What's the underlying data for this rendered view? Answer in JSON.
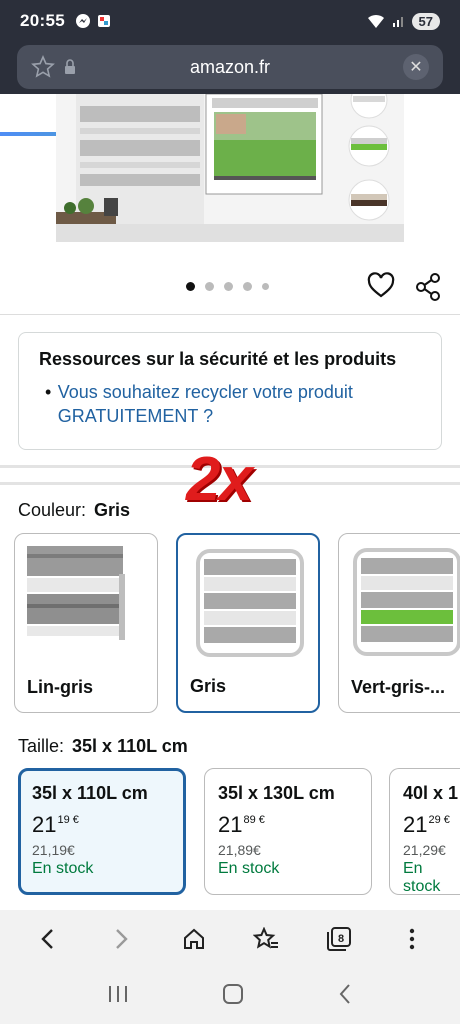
{
  "status_bar": {
    "time": "20:55",
    "battery": "57"
  },
  "url_bar": {
    "url": "amazon.fr"
  },
  "carousel": {
    "dot_count": 5,
    "active_index": 0
  },
  "resources": {
    "title": "Ressources sur la sécurité et les produits",
    "link_text": "Vous souhaitez recycler votre produit GRATUITEMENT ?"
  },
  "overlay_text": "2x",
  "color": {
    "label": "Couleur:",
    "selected": "Gris",
    "options": [
      {
        "name": "Lin-gris"
      },
      {
        "name": "Gris"
      },
      {
        "name": "Vert-gris-..."
      }
    ]
  },
  "size": {
    "label": "Taille:",
    "selected": "35l x 110L cm",
    "options": [
      {
        "name": "35l x 110L cm",
        "price_whole": "21",
        "price_fraction": "19 €",
        "price_full": "21,19€",
        "stock": "En stock"
      },
      {
        "name": "35l x 130L cm",
        "price_whole": "21",
        "price_fraction": "89 €",
        "price_full": "21,89€",
        "stock": "En stock"
      },
      {
        "name": "40l x 1",
        "price_whole": "21",
        "price_fraction": "29 €",
        "price_full": "21,29€",
        "stock": "En stock"
      }
    ]
  },
  "browser_nav": {
    "tab_count": "8"
  },
  "colors": {
    "link": "#2162a1",
    "stock_green": "#007a3e",
    "selected_border": "#2162a1",
    "overlay_red": "#e01c1c"
  }
}
